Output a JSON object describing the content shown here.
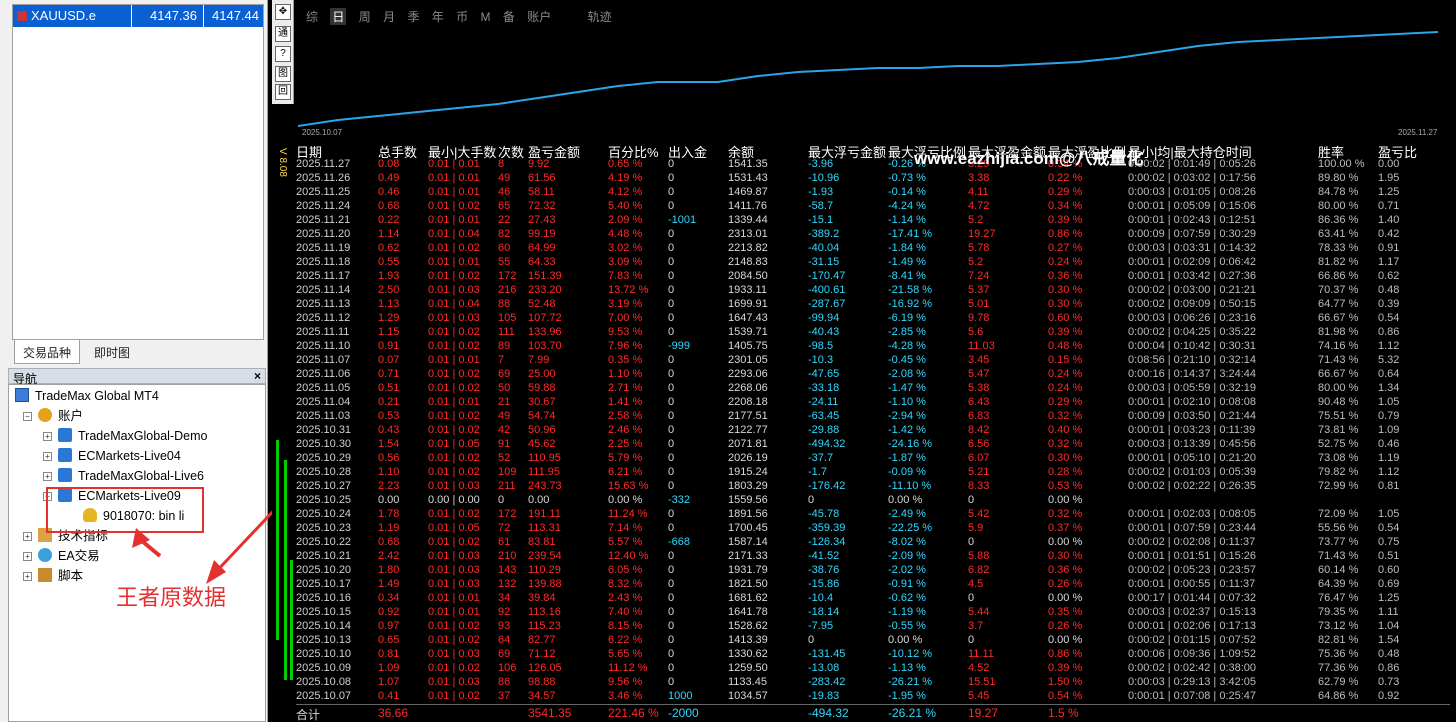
{
  "market_watch": {
    "symbol": "XAUUSD.e",
    "bid": "4147.36",
    "ask": "4147.44",
    "tabs": [
      "交易品种",
      "即时图"
    ]
  },
  "navigator": {
    "title": "导航",
    "close": "×",
    "items": [
      {
        "label": "TradeMax Global MT4",
        "icon": "mt4-terminal-icon"
      },
      {
        "label": "账户",
        "icon": "accounts-icon"
      },
      {
        "label": "TradeMaxGlobal-Demo",
        "icon": "server-icon"
      },
      {
        "label": "ECMarkets-Live04",
        "icon": "server-icon"
      },
      {
        "label": "TradeMaxGlobal-Live6",
        "icon": "server-icon"
      },
      {
        "label": "ECMarkets-Live09",
        "icon": "server-icon"
      },
      {
        "label": "9018070: bin li",
        "icon": "user-account-icon"
      },
      {
        "label": "技术指标",
        "icon": "indicator-icon"
      },
      {
        "label": "EA交易",
        "icon": "ea-icon"
      },
      {
        "label": "脚本",
        "icon": "script-icon"
      }
    ]
  },
  "annotation": {
    "text": "王者原数据"
  },
  "toolbar": [
    "通",
    "?",
    "图",
    "回"
  ],
  "chart": {
    "period_tabs": [
      "综",
      "日",
      "周",
      "月",
      "季",
      "年",
      "币",
      "M",
      "备",
      "账户",
      "轨迹"
    ],
    "active_tab": "日",
    "start_date": "2025.10.07",
    "end_date": "2025.11.27",
    "side_label": "V 8.08"
  },
  "watermark": "www.eazhijia.com@八戒量化",
  "table": {
    "headers": [
      "日期",
      "总手数",
      "最小|大手数",
      "次数",
      "盈亏金额",
      "百分比%",
      "出入金",
      "余额",
      "最大浮亏金额",
      "最大浮亏比例",
      "最大浮盈金额",
      "最大浮盈比例",
      "最小|均|最大持仓时间",
      "胜率",
      "盈亏比"
    ],
    "rows": [
      [
        "2025.11.27",
        "0.08",
        "0.01 | 0.01",
        "8",
        "9.92",
        "0.65 %",
        "0",
        "1541.35",
        "-3.96",
        "-0.26 %",
        "5.29",
        "0.34 %",
        "0:00:02 | 0:01:49 | 0:05:26",
        "100.00 %",
        "0.00"
      ],
      [
        "2025.11.26",
        "0.49",
        "0.01 | 0.01",
        "49",
        "61.56",
        "4.19 %",
        "0",
        "1531.43",
        "-10.96",
        "-0.73 %",
        "3.38",
        "0.22 %",
        "0:00:02 | 0:03:02 | 0:17:56",
        "89.80 %",
        "1.95"
      ],
      [
        "2025.11.25",
        "0.46",
        "0.01 | 0.01",
        "46",
        "58.11",
        "4.12 %",
        "0",
        "1469.87",
        "-1.93",
        "-0.14 %",
        "4.11",
        "0.29 %",
        "0:00:03 | 0:01:05 | 0:08:26",
        "84.78 %",
        "1.25"
      ],
      [
        "2025.11.24",
        "0.68",
        "0.01 | 0.02",
        "65",
        "72.32",
        "5.40 %",
        "0",
        "1411.76",
        "-58.7",
        "-4.24 %",
        "4.72",
        "0.34 %",
        "0:00:01 | 0:05:09 | 0:15:06",
        "80.00 %",
        "0.71"
      ],
      [
        "2025.11.21",
        "0.22",
        "0.01 | 0.01",
        "22",
        "27.43",
        "2.09 %",
        "-1001",
        "1339.44",
        "-15.1",
        "-1.14 %",
        "5.2",
        "0.39 %",
        "0:00:01 | 0:02:43 | 0:12:51",
        "86.36 %",
        "1.40"
      ],
      [
        "2025.11.20",
        "1.14",
        "0.01 | 0.04",
        "82",
        "99.19",
        "4.48 %",
        "0",
        "2313.01",
        "-389.2",
        "-17.41 %",
        "19.27",
        "0.86 %",
        "0:00:09 | 0:07:59 | 0:30:29",
        "63.41 %",
        "0.42"
      ],
      [
        "2025.11.19",
        "0.62",
        "0.01 | 0.02",
        "60",
        "64.99",
        "3.02 %",
        "0",
        "2213.82",
        "-40.04",
        "-1.84 %",
        "5.78",
        "0.27 %",
        "0:00:03 | 0:03:31 | 0:14:32",
        "78.33 %",
        "0.91"
      ],
      [
        "2025.11.18",
        "0.55",
        "0.01 | 0.01",
        "55",
        "64.33",
        "3.09 %",
        "0",
        "2148.83",
        "-31.15",
        "-1.49 %",
        "5.2",
        "0.24 %",
        "0:00:01 | 0:02:09 | 0:06:42",
        "81.82 %",
        "1.17"
      ],
      [
        "2025.11.17",
        "1.93",
        "0.01 | 0.02",
        "172",
        "151.39",
        "7.83 %",
        "0",
        "2084.50",
        "-170.47",
        "-8.41 %",
        "7.24",
        "0.36 %",
        "0:00:01 | 0:03:42 | 0:27:36",
        "66.86 %",
        "0.62"
      ],
      [
        "2025.11.14",
        "2.50",
        "0.01 | 0.03",
        "216",
        "233.20",
        "13.72 %",
        "0",
        "1933.11",
        "-400.61",
        "-21.58 %",
        "5.37",
        "0.30 %",
        "0:00:02 | 0:03:00 | 0:21:21",
        "70.37 %",
        "0.48"
      ],
      [
        "2025.11.13",
        "1.13",
        "0.01 | 0.04",
        "88",
        "52.48",
        "3.19 %",
        "0",
        "1699.91",
        "-287.67",
        "-16.92 %",
        "5.01",
        "0.30 %",
        "0:00:02 | 0:09:09 | 0:50:15",
        "64.77 %",
        "0.39"
      ],
      [
        "2025.11.12",
        "1.29",
        "0.01 | 0.03",
        "105",
        "107.72",
        "7.00 %",
        "0",
        "1647.43",
        "-99.94",
        "-6.19 %",
        "9.78",
        "0.60 %",
        "0:00:03 | 0:06:26 | 0:23:16",
        "66.67 %",
        "0.54"
      ],
      [
        "2025.11.11",
        "1.15",
        "0.01 | 0.02",
        "111",
        "133.96",
        "9.53 %",
        "0",
        "1539.71",
        "-40.43",
        "-2.85 %",
        "5.6",
        "0.39 %",
        "0:00:02 | 0:04:25 | 0:35:22",
        "81.98 %",
        "0.86"
      ],
      [
        "2025.11.10",
        "0.91",
        "0.01 | 0.02",
        "89",
        "103.70",
        "7.96 %",
        "-999",
        "1405.75",
        "-98.5",
        "-4.28 %",
        "11.03",
        "0.48 %",
        "0:00:04 | 0:10:42 | 0:30:31",
        "74.16 %",
        "1.12"
      ],
      [
        "2025.11.07",
        "0.07",
        "0.01 | 0.01",
        "7",
        "7.99",
        "0.35 %",
        "0",
        "2301.05",
        "-10.3",
        "-0.45 %",
        "3.45",
        "0.15 %",
        "0:08:56 | 0:21:10 | 0:32:14",
        "71.43 %",
        "5.32"
      ],
      [
        "2025.11.06",
        "0.71",
        "0.01 | 0.02",
        "69",
        "25.00",
        "1.10 %",
        "0",
        "2293.06",
        "-47.65",
        "-2.08 %",
        "5.47",
        "0.24 %",
        "0:00:16 | 0:14:37 | 3:24:44",
        "66.67 %",
        "0.64"
      ],
      [
        "2025.11.05",
        "0.51",
        "0.01 | 0.02",
        "50",
        "59.88",
        "2.71 %",
        "0",
        "2268.06",
        "-33.18",
        "-1.47 %",
        "5.38",
        "0.24 %",
        "0:00:03 | 0:05:59 | 0:32:19",
        "80.00 %",
        "1.34"
      ],
      [
        "2025.11.04",
        "0.21",
        "0.01 | 0.01",
        "21",
        "30.67",
        "1.41 %",
        "0",
        "2208.18",
        "-24.11",
        "-1.10 %",
        "6.43",
        "0.29 %",
        "0:00:01 | 0:02:10 | 0:08:08",
        "90.48 %",
        "1.05"
      ],
      [
        "2025.11.03",
        "0.53",
        "0.01 | 0.02",
        "49",
        "54.74",
        "2.58 %",
        "0",
        "2177.51",
        "-63.45",
        "-2.94 %",
        "6.83",
        "0.32 %",
        "0:00:09 | 0:03:50 | 0:21:44",
        "75.51 %",
        "0.79"
      ],
      [
        "2025.10.31",
        "0.43",
        "0.01 | 0.02",
        "42",
        "50.96",
        "2.46 %",
        "0",
        "2122.77",
        "-29.88",
        "-1.42 %",
        "8.42",
        "0.40 %",
        "0:00:01 | 0:03:23 | 0:11:39",
        "73.81 %",
        "1.09"
      ],
      [
        "2025.10.30",
        "1.54",
        "0.01 | 0.05",
        "91",
        "45.62",
        "2.25 %",
        "0",
        "2071.81",
        "-494.32",
        "-24.16 %",
        "6.56",
        "0.32 %",
        "0:00:03 | 0:13:39 | 0:45:56",
        "52.75 %",
        "0.46"
      ],
      [
        "2025.10.29",
        "0.56",
        "0.01 | 0.02",
        "52",
        "110.95",
        "5.79 %",
        "0",
        "2026.19",
        "-37.7",
        "-1.87 %",
        "6.07",
        "0.30 %",
        "0:00:01 | 0:05:10 | 0:21:20",
        "73.08 %",
        "1.19"
      ],
      [
        "2025.10.28",
        "1.10",
        "0.01 | 0.02",
        "109",
        "111.95",
        "6.21 %",
        "0",
        "1915.24",
        "-1.7",
        "-0.09 %",
        "5.21",
        "0.28 %",
        "0:00:02 | 0:01:03 | 0:05:39",
        "79.82 %",
        "1.12"
      ],
      [
        "2025.10.27",
        "2.23",
        "0.01 | 0.03",
        "211",
        "243.73",
        "15.63 %",
        "0",
        "1803.29",
        "-176.42",
        "-11.10 %",
        "8.33",
        "0.53 %",
        "0:00:02 | 0:02:22 | 0:26:35",
        "72.99 %",
        "0.81"
      ],
      [
        "2025.10.25",
        "0.00",
        "0.00 | 0.00",
        "0",
        "0.00",
        "0.00 %",
        "-332",
        "1559.56",
        "0",
        "0.00 %",
        "0",
        "0.00 %",
        "",
        "",
        ""
      ],
      [
        "2025.10.24",
        "1.78",
        "0.01 | 0.02",
        "172",
        "191.11",
        "11.24 %",
        "0",
        "1891.56",
        "-45.78",
        "-2.49 %",
        "5.42",
        "0.32 %",
        "0:00:01 | 0:02:03 | 0:08:05",
        "72.09 %",
        "1.05"
      ],
      [
        "2025.10.23",
        "1.19",
        "0.01 | 0.05",
        "72",
        "113.31",
        "7.14 %",
        "0",
        "1700.45",
        "-359.39",
        "-22.25 %",
        "5.9",
        "0.37 %",
        "0:00:01 | 0:07:59 | 0:23:44",
        "55.56 %",
        "0.54"
      ],
      [
        "2025.10.22",
        "0.68",
        "0.01 | 0.02",
        "61",
        "83.81",
        "5.57 %",
        "-668",
        "1587.14",
        "-126.34",
        "-8.02 %",
        "0",
        "0.00 %",
        "0:00:02 | 0:02:08 | 0:11:37",
        "73.77 %",
        "0.75"
      ],
      [
        "2025.10.21",
        "2.42",
        "0.01 | 0.03",
        "210",
        "239.54",
        "12.40 %",
        "0",
        "2171.33",
        "-41.52",
        "-2.09 %",
        "5.88",
        "0.30 %",
        "0:00:01 | 0:01:51 | 0:15:26",
        "71.43 %",
        "0.51"
      ],
      [
        "2025.10.20",
        "1.80",
        "0.01 | 0.03",
        "143",
        "110.29",
        "6.05 %",
        "0",
        "1931.79",
        "-38.76",
        "-2.02 %",
        "6.82",
        "0.36 %",
        "0:00:02 | 0:05:23 | 0:23:57",
        "60.14 %",
        "0.60"
      ],
      [
        "2025.10.17",
        "1.49",
        "0.01 | 0.03",
        "132",
        "139.88",
        "8.32 %",
        "0",
        "1821.50",
        "-15.86",
        "-0.91 %",
        "4.5",
        "0.26 %",
        "0:00:01 | 0:00:55 | 0:11:37",
        "64.39 %",
        "0.69"
      ],
      [
        "2025.10.16",
        "0.34",
        "0.01 | 0.01",
        "34",
        "39.84",
        "2.43 %",
        "0",
        "1681.62",
        "-10.4",
        "-0.62 %",
        "0",
        "0.00 %",
        "0:00:17 | 0:01:44 | 0:07:32",
        "76.47 %",
        "1.25"
      ],
      [
        "2025.10.15",
        "0.92",
        "0.01 | 0.01",
        "92",
        "113.16",
        "7.40 %",
        "0",
        "1641.78",
        "-18.14",
        "-1.19 %",
        "5.44",
        "0.35 %",
        "0:00:03 | 0:02:37 | 0:15:13",
        "79.35 %",
        "1.11"
      ],
      [
        "2025.10.14",
        "0.97",
        "0.01 | 0.02",
        "93",
        "115.23",
        "8.15 %",
        "0",
        "1528.62",
        "-7.95",
        "-0.55 %",
        "3.7",
        "0.26 %",
        "0:00:01 | 0:02:06 | 0:17:13",
        "73.12 %",
        "1.04"
      ],
      [
        "2025.10.13",
        "0.65",
        "0.01 | 0.02",
        "64",
        "82.77",
        "6.22 %",
        "0",
        "1413.39",
        "0",
        "0.00 %",
        "0",
        "0.00 %",
        "0:00:02 | 0:01:15 | 0:07:52",
        "82.81 %",
        "1.54"
      ],
      [
        "2025.10.10",
        "0.81",
        "0.01 | 0.03",
        "69",
        "71.12",
        "5.65 %",
        "0",
        "1330.62",
        "-131.45",
        "-10.12 %",
        "11.11",
        "0.86 %",
        "0:00:06 | 0:09:36 | 1:09:52",
        "75.36 %",
        "0.48"
      ],
      [
        "2025.10.09",
        "1.09",
        "0.01 | 0.02",
        "106",
        "126.05",
        "11.12 %",
        "0",
        "1259.50",
        "-13.08",
        "-1.13 %",
        "4.52",
        "0.39 %",
        "0:00:02 | 0:02:42 | 0:38:00",
        "77.36 %",
        "0.86"
      ],
      [
        "2025.10.08",
        "1.07",
        "0.01 | 0.03",
        "86",
        "98.88",
        "9.56 %",
        "0",
        "1133.45",
        "-283.42",
        "-26.21 %",
        "15.51",
        "1.50 %",
        "0:00:03 | 0:29:13 | 3:42:05",
        "62.79 %",
        "0.73"
      ],
      [
        "2025.10.07",
        "0.41",
        "0.01 | 0.02",
        "37",
        "34.57",
        "3.46 %",
        "1000",
        "1034.57",
        "-19.83",
        "-1.95 %",
        "5.45",
        "0.54 %",
        "0:00:01 | 0:07:08 | 0:25:47",
        "64.86 %",
        "0.92"
      ]
    ],
    "total": {
      "label": "合计",
      "lots": "36.66",
      "pnl": "3541.35",
      "pct": "221.46 %",
      "deposit": "-2000",
      "max_loss": "-494.32",
      "max_loss_pct": "-26.21 %",
      "max_gain": "19.27",
      "max_gain_pct": "1.5 %"
    }
  },
  "colors": {
    "red": "#ff2a2a",
    "cyan": "#2fd8ff",
    "equity_line": "#2aa6e8"
  }
}
